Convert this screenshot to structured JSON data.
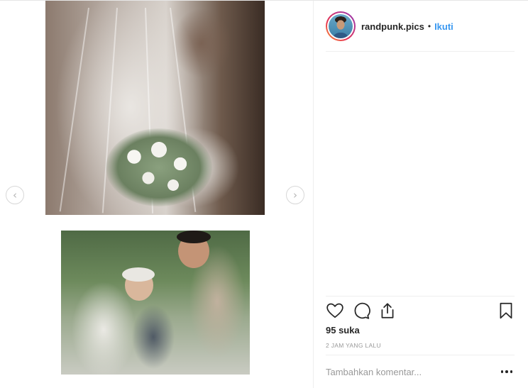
{
  "post": {
    "username": "randpunk.pics",
    "separator": "•",
    "follow_label": "Ikuti",
    "likes_text": "95 suka",
    "timestamp": "2 JAM YANG LALU",
    "comment_placeholder": "Tambahkan komentar..."
  },
  "icons": {
    "prev": "chevron-left-icon",
    "next": "chevron-right-icon",
    "like": "heart-icon",
    "comment": "comment-bubble-icon",
    "share": "share-upload-icon",
    "save": "bookmark-icon",
    "more": "more-options-icon"
  },
  "colors": {
    "accent_link": "#3897f0",
    "text_primary": "#262626",
    "text_muted": "#999999",
    "divider": "#efefef"
  }
}
